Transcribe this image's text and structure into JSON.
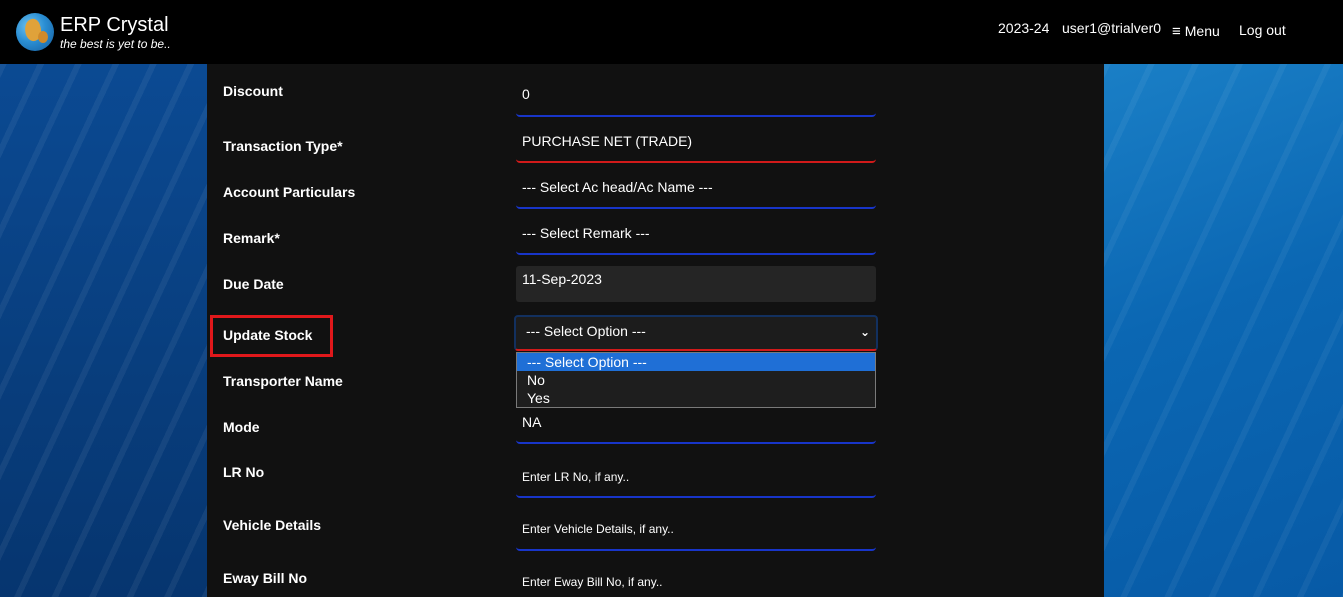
{
  "header": {
    "brand_title": "ERP Crystal",
    "brand_tagline": "the best is yet to be..",
    "fiscal_year": "2023-24",
    "user": "user1@trialver0",
    "menu_icon": "≡",
    "menu_label": "Menu",
    "logout_label": "Log out"
  },
  "form": {
    "discount": {
      "label": "Discount",
      "value": "0"
    },
    "transaction_type": {
      "label": "Transaction Type*",
      "value": "PURCHASE NET (TRADE)"
    },
    "account_particulars": {
      "label": "Account Particulars",
      "value": "--- Select Ac head/Ac Name ---"
    },
    "remark": {
      "label": "Remark*",
      "value": "--- Select Remark ---"
    },
    "due_date": {
      "label": "Due Date",
      "value": "11-Sep-2023"
    },
    "update_stock": {
      "label": "Update Stock",
      "value": "--- Select Option ---",
      "chevron_icon": "⌄",
      "options": [
        "--- Select Option ---",
        "No",
        "Yes"
      ]
    },
    "transporter_name": {
      "label": "Transporter Name"
    },
    "mode": {
      "label": "Mode",
      "value": "NA"
    },
    "lr_no": {
      "label": "LR No",
      "placeholder": "Enter LR No, if any.."
    },
    "vehicle_details": {
      "label": "Vehicle Details",
      "placeholder": "Enter Vehicle Details, if any.."
    },
    "eway_bill_no": {
      "label": "Eway Bill No",
      "placeholder": "Enter Eway Bill No, if any.."
    }
  },
  "colors": {
    "field_underline": "#1835c9",
    "required_underline": "#d11a1a",
    "highlight": "#e0181b",
    "selected_option": "#1f6fd6"
  }
}
